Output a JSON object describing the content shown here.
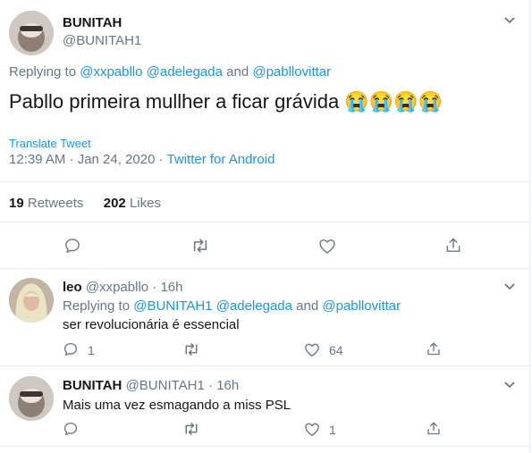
{
  "main": {
    "name": "BUNITAH",
    "handle": "@BUNITAH1",
    "replying_prefix": "Replying to",
    "replying_handle1": "@xxpabllo",
    "replying_handle2": "@adelegada",
    "replying_and": "and",
    "replying_handle3": "@pabllovittar",
    "text": "Pabllo primeira mullher a ficar grávida",
    "emoji": "😭😭😭😭",
    "translate": "Translate Tweet",
    "time": "12:39 AM · Jan 24, 2020",
    "dot": "·",
    "client": "Twitter for Android",
    "retweets_count": "19",
    "retweets_label": "Retweets",
    "likes_count": "202",
    "likes_label": "Likes"
  },
  "reply1": {
    "name": "leo",
    "handle": "@xxpabllo",
    "time": "· 16h",
    "replying_prefix": "Replying to",
    "replying_handle1": "@BUNITAH1",
    "replying_handle2": "@adelegada",
    "replying_and": "and",
    "replying_handle3": "@pabllovittar",
    "text": "ser revolucionária é essencial",
    "reply_count": "1",
    "like_count": "64"
  },
  "reply2": {
    "name": "BUNITAH",
    "handle": "@BUNITAH1",
    "time": "· 16h",
    "text": "Mais uma vez esmagando a miss PSL",
    "like_count": "1"
  },
  "icons": {
    "caret": "chevron-down-icon",
    "reply": "comment-icon",
    "retweet": "retweet-icon",
    "like": "heart-icon",
    "share": "share-icon"
  },
  "colors": {
    "link": "#1b95e0",
    "muted": "#657786",
    "text": "#14171a",
    "divider": "#e6ecf0"
  }
}
